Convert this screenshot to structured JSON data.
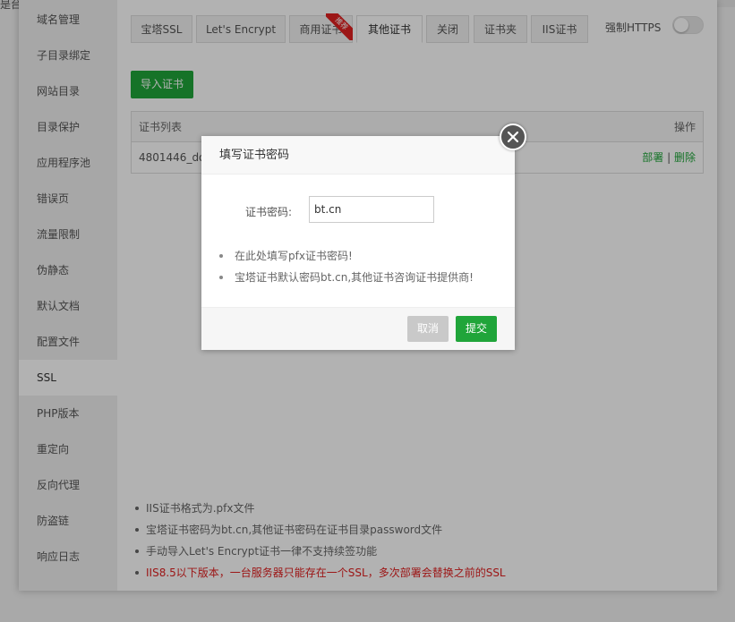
{
  "background": {
    "top_text": "是台"
  },
  "sidebar": {
    "items": [
      {
        "label": "域名管理"
      },
      {
        "label": "子目录绑定"
      },
      {
        "label": "网站目录"
      },
      {
        "label": "目录保护"
      },
      {
        "label": "应用程序池"
      },
      {
        "label": "错误页"
      },
      {
        "label": "流量限制"
      },
      {
        "label": "伪静态"
      },
      {
        "label": "默认文档"
      },
      {
        "label": "配置文件"
      },
      {
        "label": "SSL",
        "active": true
      },
      {
        "label": "PHP版本"
      },
      {
        "label": "重定向"
      },
      {
        "label": "反向代理"
      },
      {
        "label": "防盗链"
      },
      {
        "label": "响应日志"
      }
    ]
  },
  "tabs": [
    {
      "label": "宝塔SSL"
    },
    {
      "label": "Let's Encrypt"
    },
    {
      "label": "商用证书",
      "ribbon": "推荐"
    },
    {
      "label": "其他证书",
      "active": true
    },
    {
      "label": "关闭"
    },
    {
      "label": "证书夹"
    },
    {
      "label": "IIS证书"
    }
  ],
  "https": {
    "label": "强制HTTPS",
    "enabled": false
  },
  "import_button": "导入证书",
  "cert_table": {
    "header_name": "证书列表",
    "header_ops": "操作",
    "rows": [
      {
        "name": "4801446_do",
        "deploy": "部署",
        "sep": " | ",
        "delete": "删除"
      }
    ]
  },
  "tips": [
    "IIS证书格式为.pfx文件",
    "宝塔证书密码为bt.cn,其他证书密码在证书目录password文件",
    "手动导入Let's Encrypt证书一律不支持续签功能",
    "IIS8.5以下版本，一台服务器只能存在一个SSL，多次部署会替换之前的SSL"
  ],
  "modal": {
    "title": "填写证书密码",
    "password_label": "证书密码:",
    "password_value": "bt.cn",
    "tips": [
      "在此处填写pfx证书密码!",
      "宝塔证书默认密码bt.cn,其他证书咨询证书提供商!"
    ],
    "cancel": "取消",
    "submit": "提交"
  },
  "colors": {
    "accent_green": "#20a53a",
    "warning_red": "#e02020",
    "disabled_gray": "#c9c9c9"
  }
}
